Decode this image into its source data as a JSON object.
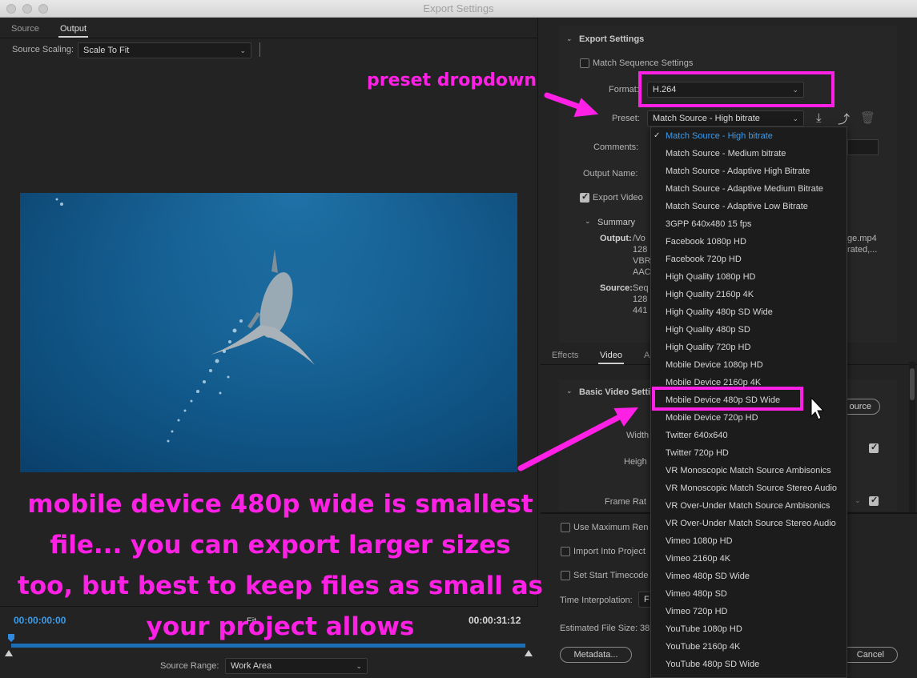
{
  "window": {
    "title": "Export Settings"
  },
  "left": {
    "tabs": [
      "Source",
      "Output"
    ],
    "source_scaling_label": "Source Scaling:",
    "source_scaling_value": "Scale To Fit",
    "timecode_start": "00:00:00:00",
    "timecode_end": "00:00:31:12",
    "source_range_label": "Source Range:",
    "source_range_value": "Work Area",
    "fit_fragment": "Fit"
  },
  "export_settings": {
    "section_title": "Export Settings",
    "match_sequence": "Match Sequence Settings",
    "format_label": "Format:",
    "format_value": "H.264",
    "preset_label": "Preset:",
    "preset_value": "Match Source - High bitrate",
    "comments_label": "Comments:",
    "output_name_label": "Output Name:",
    "export_video": "Export Video",
    "summary_label": "Summary",
    "output_label": "Output:",
    "output_lines": [
      "/Vo",
      "128",
      "VBR",
      "AAC"
    ],
    "output_right": [
      "ge.mp4",
      "rated,..."
    ],
    "source_label": "Source:",
    "source_lines": [
      "Seq",
      "128",
      "441"
    ]
  },
  "lower_tabs": [
    "Effects",
    "Video",
    "A"
  ],
  "video": {
    "basic_label": "Basic Video Setti",
    "width_label": "Width",
    "height_label": "Heigh",
    "frame_rate_label": "Frame Rat",
    "source_button": "ource"
  },
  "bottom": {
    "use_max": "Use Maximum Ren",
    "import_project": "Import Into Project",
    "set_start_tc": "Set Start Timecode",
    "time_interp_label": "Time Interpolation:",
    "time_interp_value": "F",
    "est_size_label": "Estimated File Size:",
    "est_size_value": "38",
    "metadata_button": "Metadata...",
    "cancel_button": "Cancel"
  },
  "preset_menu": {
    "items": [
      "Match Source - High bitrate",
      "Match Source - Medium bitrate",
      "Match Source - Adaptive High Bitrate",
      "Match Source - Adaptive Medium Bitrate",
      "Match Source - Adaptive Low Bitrate",
      "3GPP 640x480 15 fps",
      "Facebook 1080p HD",
      "Facebook 720p HD",
      "High Quality 1080p HD",
      "High Quality 2160p 4K",
      "High Quality 480p SD Wide",
      "High Quality 480p SD",
      "High Quality 720p HD",
      "Mobile Device 1080p HD",
      "Mobile Device 2160p 4K",
      "Mobile Device 480p SD Wide",
      "Mobile Device 720p HD",
      "Twitter 640x640",
      "Twitter 720p HD",
      "VR Monoscopic Match Source Ambisonics",
      "VR Monoscopic Match Source Stereo Audio",
      "VR Over-Under Match Source Ambisonics",
      "VR Over-Under Match Source Stereo Audio",
      "Vimeo 1080p HD",
      "Vimeo 2160p 4K",
      "Vimeo 480p SD Wide",
      "Vimeo 480p SD",
      "Vimeo 720p HD",
      "YouTube 1080p HD",
      "YouTube 2160p 4K",
      "YouTube 480p SD Wide"
    ],
    "selected": "Match Source - High bitrate",
    "highlighted": "Mobile Device 480p SD Wide"
  },
  "annotations": {
    "preset_note": "preset dropdown",
    "mobile_note": [
      "mobile device 480p wide is smallest",
      "file... you can export larger sizes",
      "too, but best to keep files as small as",
      "your project allows"
    ],
    "color": "#ff20e6"
  }
}
